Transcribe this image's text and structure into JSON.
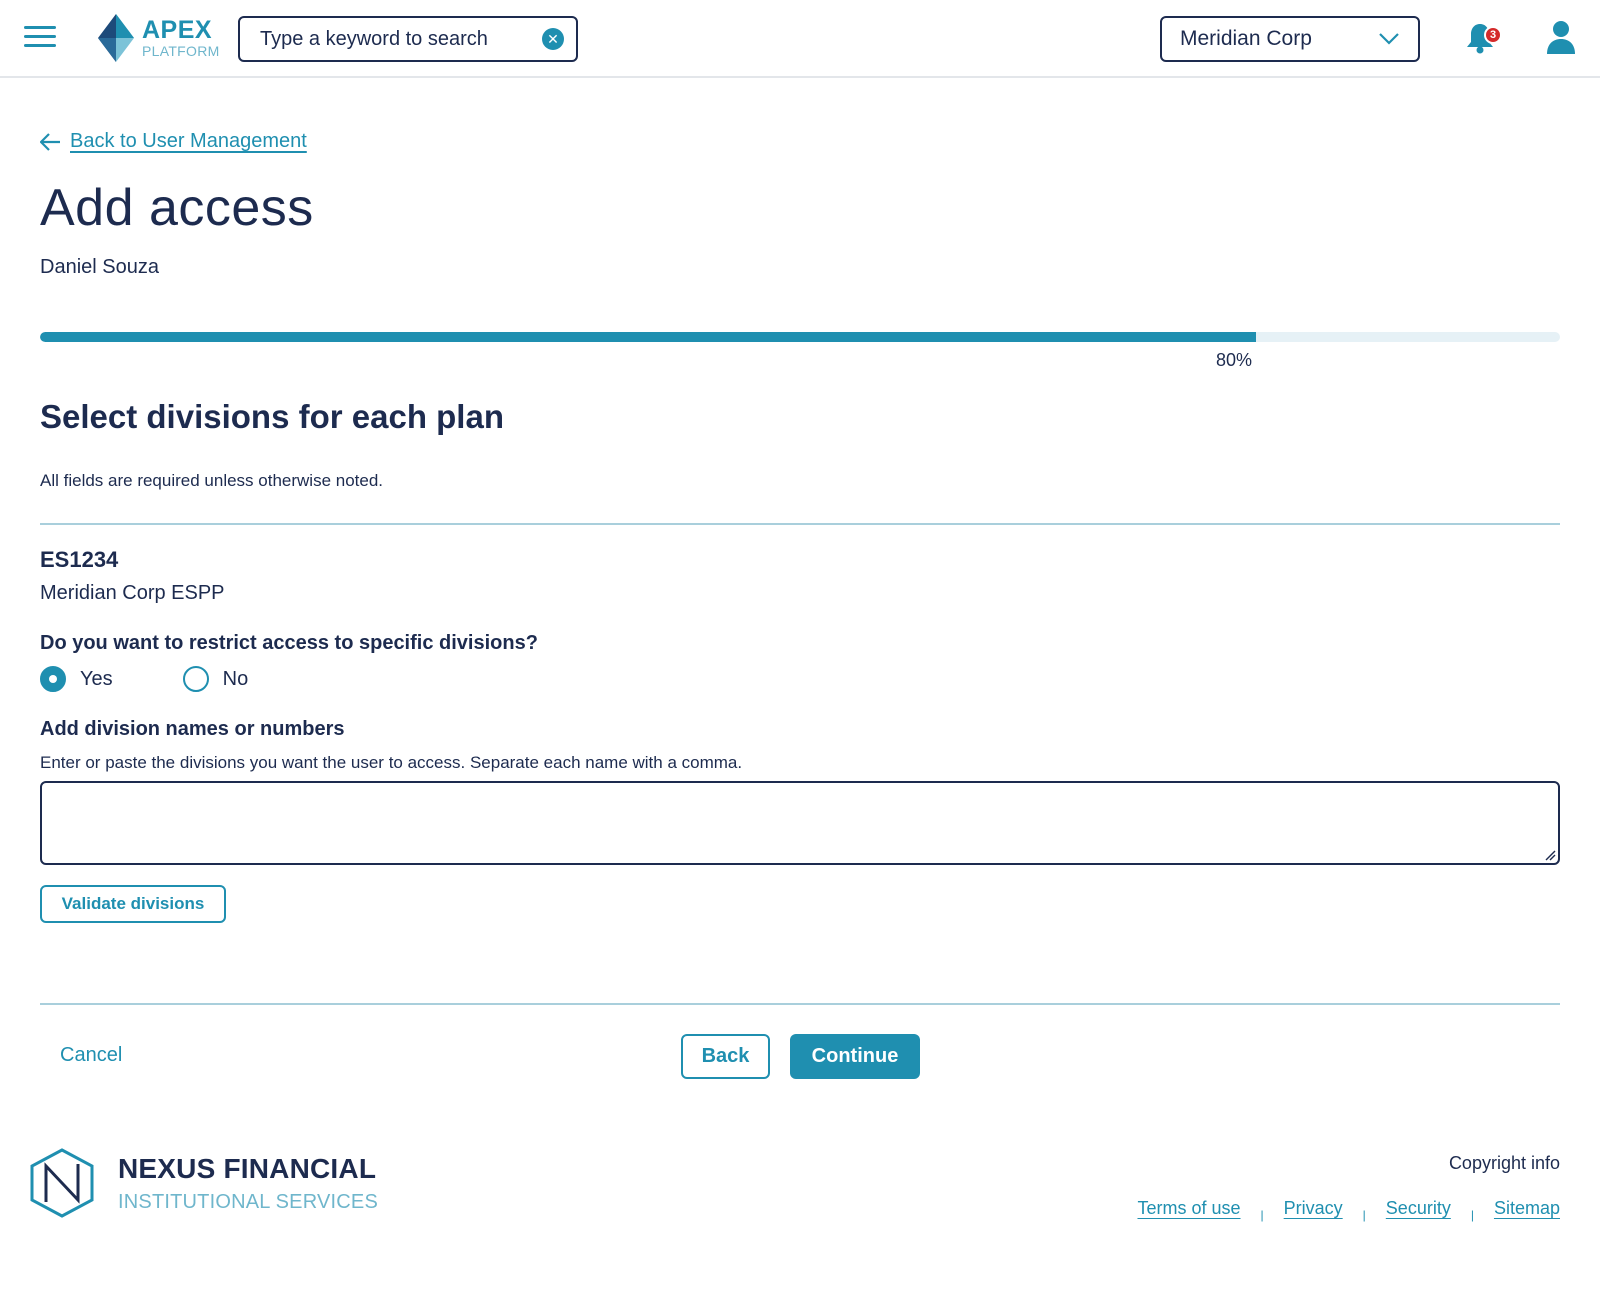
{
  "header": {
    "logo_name": "APEX",
    "logo_sub": "PLATFORM",
    "search_placeholder": "Type a keyword to search",
    "company": "Meridian Corp",
    "notifications_count": "3"
  },
  "main": {
    "back_link": "Back to User Management",
    "title": "Add access",
    "user_name": "Daniel Souza",
    "progress": {
      "value": 0.8,
      "label": "80%"
    },
    "section_title": "Select divisions for each plan",
    "required_note": "All fields are required unless otherwise noted.",
    "plan": {
      "id": "ES1234",
      "name": "Meridian Corp ESPP"
    },
    "question": "Do you want to restrict access to specific divisions?",
    "radio_yes": "Yes",
    "radio_no": "No",
    "selected": "Yes",
    "division_label": "Add division names or numbers",
    "division_help": "Enter or paste the divisions you want the user to access. Separate each name with a comma.",
    "division_value": "",
    "validate_label": "Validate divisions",
    "cancel_label": "Cancel",
    "back_label": "Back",
    "continue_label": "Continue"
  },
  "footer": {
    "brand_name": "NEXUS FINANCIAL",
    "brand_sub": "INSTITUTIONAL SERVICES",
    "copyright": "Copyright info",
    "links": [
      "Terms of use",
      "Privacy",
      "Security",
      "Sitemap"
    ]
  },
  "colors": {
    "accent": "#1f8fb0",
    "text": "#1d2b4f",
    "light": "#6fb6cc",
    "badge": "#d42a2a"
  },
  "icons": [
    "menu-icon",
    "apex-logo-icon",
    "clear-icon",
    "chevron-down-icon",
    "bell-icon",
    "user-icon",
    "arrow-left-icon",
    "resize-grip-icon",
    "nexus-logo-icon"
  ]
}
